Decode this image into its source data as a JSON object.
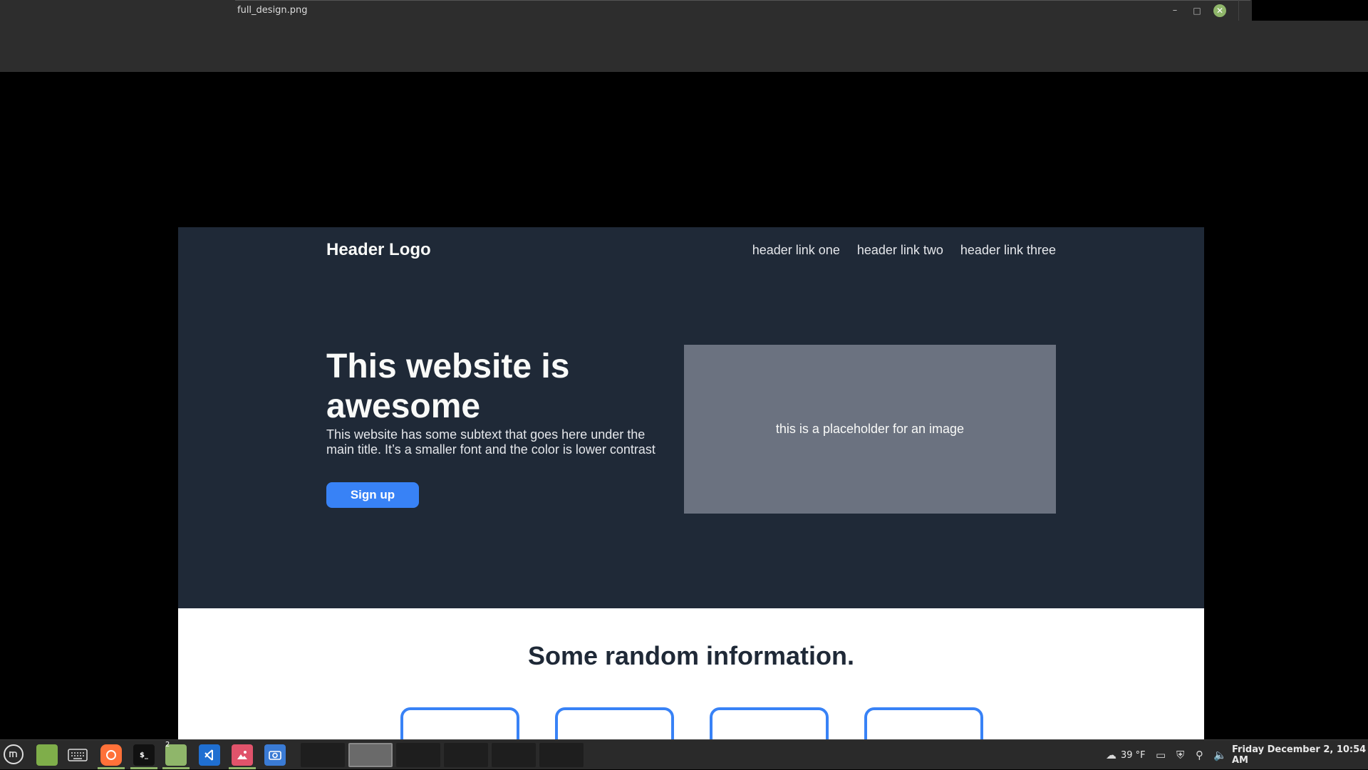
{
  "window": {
    "title": "full_design.png",
    "minimize_glyph": "–",
    "maximize_glyph": "□",
    "close_glyph": "✕"
  },
  "design": {
    "header": {
      "logo": "Header Logo",
      "links": [
        "header link one",
        "header link two",
        "header link three"
      ]
    },
    "hero": {
      "title": "This website is awesome",
      "subtext": "This website has some subtext that goes here under the main title.  It’s a smaller font and the color is lower contrast",
      "signup_label": "Sign up",
      "image_placeholder": "this is a placeholder for an image"
    },
    "info": {
      "title": "Some random information.",
      "card_count": 4
    },
    "colors": {
      "hero_bg": "#1f2937",
      "accent": "#3882f6",
      "image_bg": "#6b7280"
    }
  },
  "taskbar": {
    "workspace_badge": "2",
    "terminal_glyph": "$_",
    "weather": "39 °F",
    "clock": "Friday December  2, 10:54 AM",
    "launchers": [
      "menu-icon",
      "files-icon",
      "keyboard-icon",
      "firefox-icon",
      "terminal-icon",
      "folder-icon",
      "vscode-icon",
      "image-viewer-icon",
      "screenshot-icon"
    ],
    "tray_icons": [
      "weather-icon",
      "display-icon",
      "shield-icon",
      "network-icon",
      "volume-icon"
    ]
  }
}
